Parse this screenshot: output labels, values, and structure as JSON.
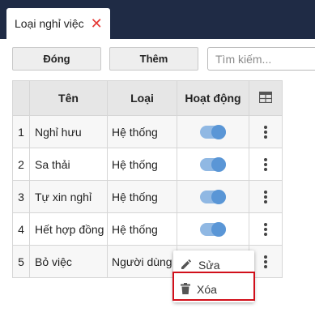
{
  "tab": {
    "label": "Loại nghỉ việc",
    "close_glyph": "✕"
  },
  "toolbar": {
    "close_label": "Đóng",
    "add_label": "Thêm",
    "search_placeholder": "Tìm kiếm...",
    "search_value": ""
  },
  "table": {
    "headers": {
      "num": "",
      "name": "Tên",
      "type": "Loại",
      "active": "Hoạt động",
      "columns_icon": "table-columns-icon"
    },
    "rows": [
      {
        "num": "1",
        "name": "Nghỉ hưu",
        "type": "Hệ thống",
        "active": true
      },
      {
        "num": "2",
        "name": "Sa thải",
        "type": "Hệ thống",
        "active": true
      },
      {
        "num": "3",
        "name": "Tự xin nghỉ",
        "type": "Hệ thống",
        "active": true
      },
      {
        "num": "4",
        "name": "Hết hợp đồng",
        "type": "Hệ thống",
        "active": true
      },
      {
        "num": "5",
        "name": "Bỏ việc",
        "type": "Người dùng",
        "active": null
      }
    ]
  },
  "context_menu": {
    "items": [
      {
        "label": "Sửa",
        "icon": "pencil-icon"
      },
      {
        "label": "Xóa",
        "icon": "trash-icon"
      }
    ]
  },
  "colors": {
    "topbar": "#1f2b45",
    "close_x": "#e53935",
    "toggle_track": "#90b8e3",
    "toggle_knob": "#5a96d6",
    "highlight_border": "#d10f1a"
  }
}
